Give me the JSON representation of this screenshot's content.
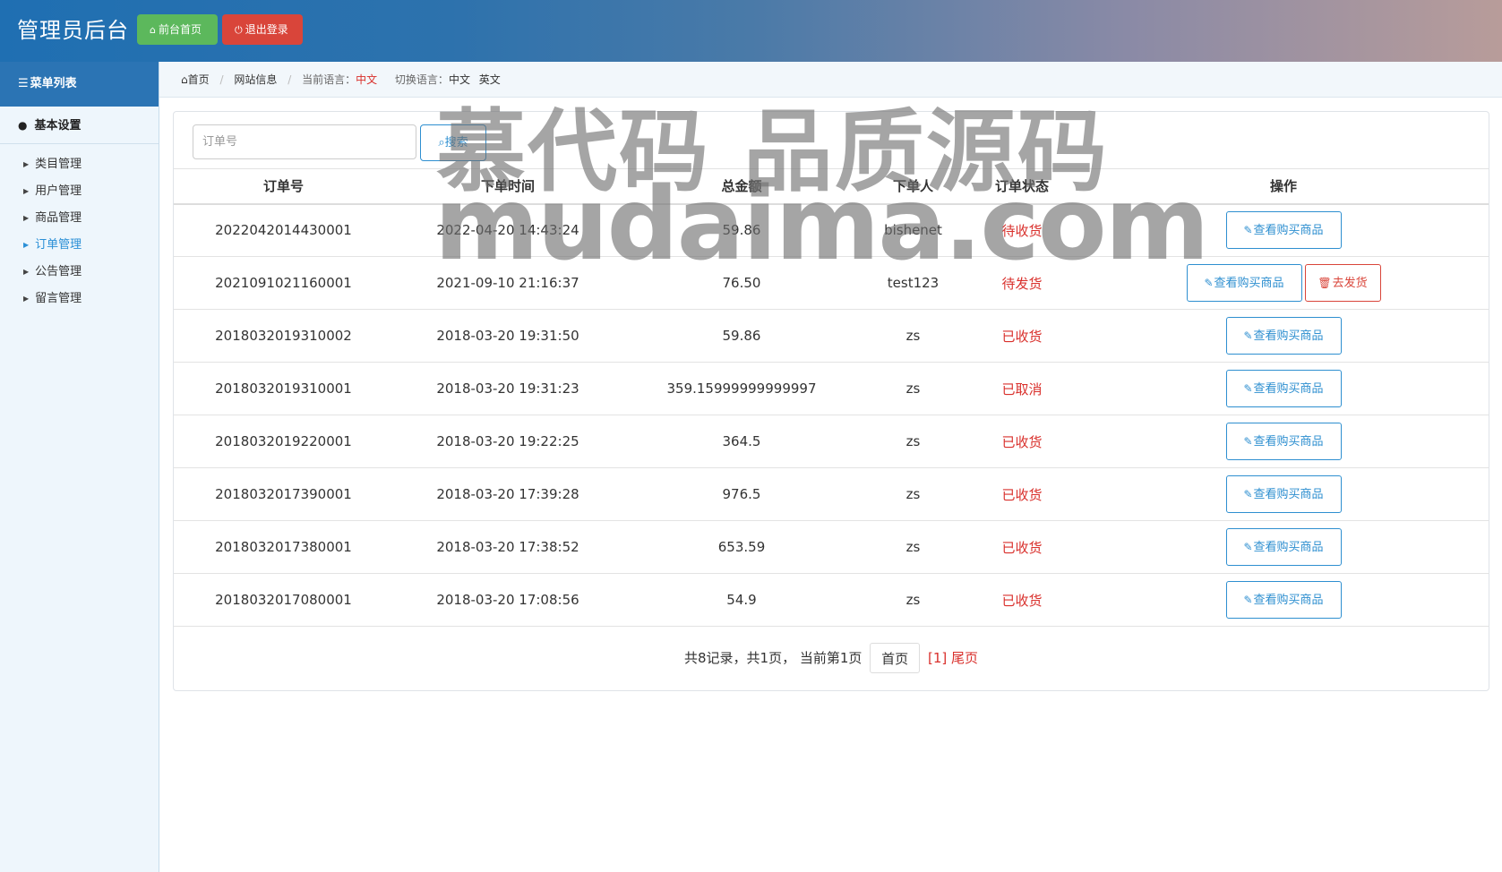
{
  "header": {
    "brand": "管理员后台",
    "home_label": "前台首页",
    "logout_label": "退出登录"
  },
  "sidebar": {
    "title": "菜单列表",
    "group": "基本设置",
    "items": [
      {
        "label": "类目管理",
        "active": false
      },
      {
        "label": "用户管理",
        "active": false
      },
      {
        "label": "商品管理",
        "active": false
      },
      {
        "label": "订单管理",
        "active": true
      },
      {
        "label": "公告管理",
        "active": false
      },
      {
        "label": "留言管理",
        "active": false
      }
    ]
  },
  "breadcrumb": {
    "home": "首页",
    "site_info": "网站信息",
    "current_lang_label": "当前语言：",
    "current_lang": "中文",
    "switch_label": "切换语言：",
    "lang_zh": "中文",
    "lang_en": "英文"
  },
  "search": {
    "placeholder": "订单号",
    "button_label": "搜索"
  },
  "table": {
    "headers": [
      "订单号",
      "下单时间",
      "总金额",
      "下单人",
      "订单状态",
      "操作"
    ],
    "view_label": "查看购买商品",
    "ship_label": "去发货",
    "rows": [
      {
        "order_no": "2022042014430001",
        "time": "2022-04-20 14:43:24",
        "amount": "59.86",
        "user": "bishenet",
        "status": "待收货",
        "can_ship": false
      },
      {
        "order_no": "2021091021160001",
        "time": "2021-09-10 21:16:37",
        "amount": "76.50",
        "user": "test123",
        "status": "待发货",
        "can_ship": true
      },
      {
        "order_no": "2018032019310002",
        "time": "2018-03-20 19:31:50",
        "amount": "59.86",
        "user": "zs",
        "status": "已收货",
        "can_ship": false
      },
      {
        "order_no": "2018032019310001",
        "time": "2018-03-20 19:31:23",
        "amount": "359.15999999999997",
        "user": "zs",
        "status": "已取消",
        "can_ship": false
      },
      {
        "order_no": "2018032019220001",
        "time": "2018-03-20 19:22:25",
        "amount": "364.5",
        "user": "zs",
        "status": "已收货",
        "can_ship": false
      },
      {
        "order_no": "2018032017390001",
        "time": "2018-03-20 17:39:28",
        "amount": "976.5",
        "user": "zs",
        "status": "已收货",
        "can_ship": false
      },
      {
        "order_no": "2018032017380001",
        "time": "2018-03-20 17:38:52",
        "amount": "653.59",
        "user": "zs",
        "status": "已收货",
        "can_ship": false
      },
      {
        "order_no": "2018032017080001",
        "time": "2018-03-20 17:08:56",
        "amount": "54.9",
        "user": "zs",
        "status": "已收货",
        "can_ship": false
      }
    ]
  },
  "pager": {
    "summary": "共8记录，共1页，  当前第1页",
    "first_label": "首页",
    "current_page": "[1]",
    "last_label": "尾页"
  },
  "watermark": {
    "line1": "慕代码 品质源码",
    "line2": "mudaima.com"
  },
  "colors": {
    "primary": "#2e8fd0",
    "danger": "#d9302c",
    "success": "#5cb85c",
    "sidebar_bg": "#eef6fc"
  }
}
